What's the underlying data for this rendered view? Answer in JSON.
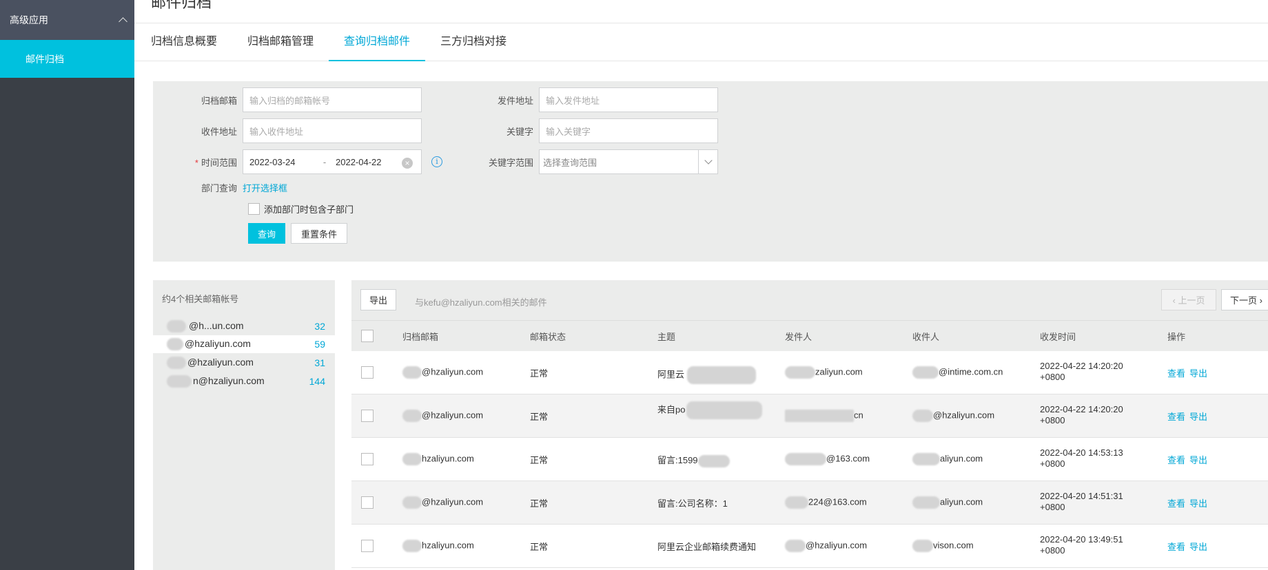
{
  "sidebar": {
    "group_label": "高级应用",
    "active_item": "邮件归档"
  },
  "header": {
    "page_title": "邮件归档"
  },
  "tabs": [
    {
      "label": "归档信息概要",
      "active": false
    },
    {
      "label": "归档邮箱管理",
      "active": false
    },
    {
      "label": "查询归档邮件",
      "active": true
    },
    {
      "label": "三方归档对接",
      "active": false
    }
  ],
  "filter": {
    "archive_mailbox": {
      "label": "归档邮箱",
      "placeholder": "输入归档的邮箱帐号"
    },
    "sender": {
      "label": "发件地址",
      "placeholder": "输入发件地址"
    },
    "recipient": {
      "label": "收件地址",
      "placeholder": "输入收件地址"
    },
    "keyword": {
      "label": "关键字",
      "placeholder": "输入关键字"
    },
    "time_range": {
      "label": "时间范围",
      "required_mark": "*",
      "start": "2022-03-24",
      "separator": "-",
      "end": "2022-04-22"
    },
    "keyword_scope": {
      "label": "关键字范围",
      "placeholder": "选择查询范围"
    },
    "department": {
      "label": "部门查询",
      "link": "打开选择框"
    },
    "include_sub": {
      "label": "添加部门时包含子部门",
      "checked": false
    },
    "search_button": "查询",
    "reset_button": "重置条件"
  },
  "accounts": {
    "title": "约4个相关邮箱帐号",
    "items": [
      {
        "email": "@h...un.com",
        "count": "32",
        "selected": false
      },
      {
        "email": "@hzaliyun.com",
        "count": "59",
        "selected": true
      },
      {
        "email": "@hzaliyun.com",
        "count": "31",
        "selected": false
      },
      {
        "email": "n@hzaliyun.com",
        "count": "144",
        "selected": false
      }
    ]
  },
  "results": {
    "export_button": "导出",
    "description": "与kefu@hzaliyun.com相关的邮件",
    "prev_page": "‹ 上一页",
    "next_page": "下一页 ›",
    "columns": [
      "归档邮箱",
      "邮箱状态",
      "主题",
      "发件人",
      "收件人",
      "收发时间",
      "操作"
    ],
    "rows": [
      {
        "mailbox": "@hzaliyun.com",
        "status": "正常",
        "subject": "阿里云",
        "from": "zaliyun.com",
        "to": "@intime.com.cn",
        "time": "2022-04-22 14:20:20 +0800",
        "view": "查看",
        "export": "导出"
      },
      {
        "mailbox": "@hzaliyun.com",
        "status": "正常",
        "subject": "来自po",
        "from": "cn",
        "to": "@hzaliyun.com",
        "time": "2022-04-22 14:20:20 +0800",
        "view": "查看",
        "export": "导出"
      },
      {
        "mailbox": "hzaliyun.com",
        "status": "正常",
        "subject": "留言:1599",
        "from": "@163.com",
        "to": "aliyun.com",
        "time": "2022-04-20 14:53:13 +0800",
        "view": "查看",
        "export": "导出"
      },
      {
        "mailbox": "@hzaliyun.com",
        "status": "正常",
        "subject": "留言:公司名称：1",
        "from": "224@163.com",
        "to": "aliyun.com",
        "time": "2022-04-20 14:51:31 +0800",
        "view": "查看",
        "export": "导出"
      },
      {
        "mailbox": "hzaliyun.com",
        "status": "正常",
        "subject": "阿里云企业邮箱续费通知",
        "from": "@hzaliyun.com",
        "to": "vison.com",
        "time": "2022-04-20 13:49:51 +0800",
        "view": "查看",
        "export": "导出"
      }
    ]
  },
  "colors": {
    "accent": "#00c1de",
    "link": "#00a7d6",
    "sidebar_bg": "#3a3f46",
    "panel_bg": "#ebeceb"
  }
}
